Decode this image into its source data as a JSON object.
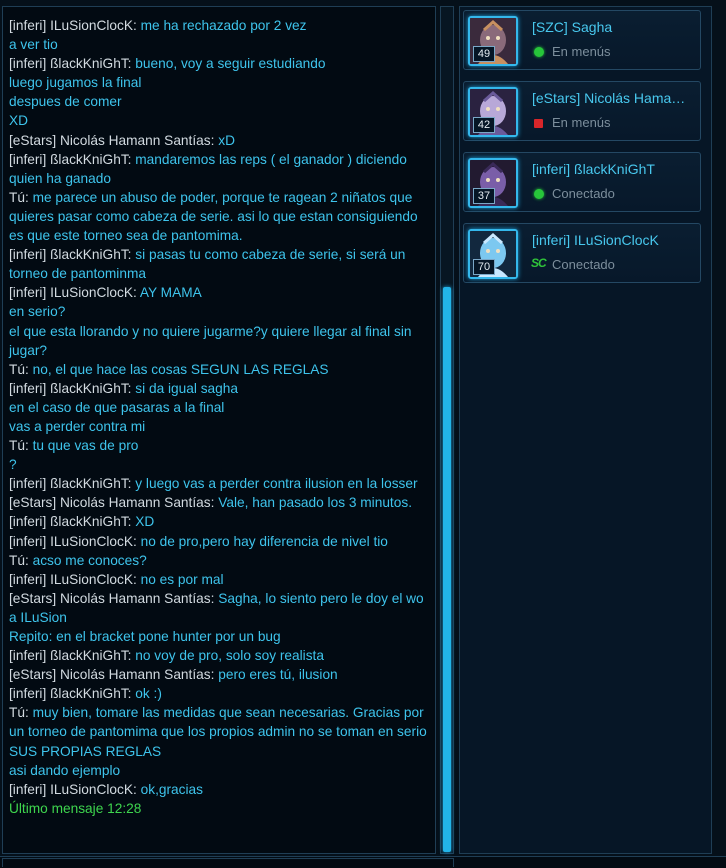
{
  "chat": {
    "lines": [
      {
        "sender": "[inferi] ILuSionClocK:",
        "text": "me ha rechazado por 2 vez"
      },
      {
        "sender": "",
        "text": "a ver tio"
      },
      {
        "sender": "[inferi] ßlackKniGhT:",
        "text": "bueno, voy a seguir estudiando"
      },
      {
        "sender": "",
        "text": "luego jugamos la final"
      },
      {
        "sender": "",
        "text": "despues de comer"
      },
      {
        "sender": "",
        "text": "XD"
      },
      {
        "sender": "[eStars] Nicolás Hamann Santías:",
        "text": "xD"
      },
      {
        "sender": "[inferi] ßlackKniGhT:",
        "text": "mandaremos las reps ( el ganador ) diciendo quien ha ganado"
      },
      {
        "sender": "Tú:",
        "text": "me parece un abuso de poder, porque te ragean 2 niñatos que quieres pasar como cabeza de serie. asi lo que estan consiguiendo es que este torneo sea de pantomima."
      },
      {
        "sender": "[inferi] ßlackKniGhT:",
        "text": "si pasas tu como cabeza de serie, si será un torneo de pantominma"
      },
      {
        "sender": "[inferi] ILuSionClocK:",
        "text": "AY MAMA"
      },
      {
        "sender": "",
        "text": "en serio?"
      },
      {
        "sender": "",
        "text": "el que esta llorando y no quiere jugarme?y quiere llegar  al final sin jugar?"
      },
      {
        "sender": "Tú:",
        "text": "no, el que hace las cosas SEGUN LAS REGLAS"
      },
      {
        "sender": "[inferi] ßlackKniGhT:",
        "text": "si da igual sagha"
      },
      {
        "sender": "",
        "text": "en el caso de que pasaras a la final"
      },
      {
        "sender": "",
        "text": "vas a perder contra mi"
      },
      {
        "sender": "Tú:",
        "text": "tu que vas de pro"
      },
      {
        "sender": "",
        "text": "?"
      },
      {
        "sender": "[inferi] ßlackKniGhT:",
        "text": "y luego vas a perder contra ilusion en la losser"
      },
      {
        "sender": "[eStars] Nicolás Hamann Santías:",
        "text": "Vale, han pasado los 3 minutos."
      },
      {
        "sender": "[inferi] ßlackKniGhT:",
        "text": "XD"
      },
      {
        "sender": "[inferi] ILuSionClocK:",
        "text": "no de pro,pero hay diferencia de nivel tio"
      },
      {
        "sender": "Tú:",
        "text": "acso me conoces?"
      },
      {
        "sender": "[inferi] ILuSionClocK:",
        "text": "no es por mal"
      },
      {
        "sender": "[eStars] Nicolás Hamann Santías:",
        "text": "Sagha, lo siento pero le doy el wo a ILuSion"
      },
      {
        "sender": "",
        "text": "Repito: en el bracket pone hunter por un bug"
      },
      {
        "sender": "[inferi] ßlackKniGhT:",
        "text": "no voy de pro, solo soy realista"
      },
      {
        "sender": "[eStars] Nicolás Hamann Santías:",
        "text": "pero eres tú, ilusion"
      },
      {
        "sender": "[inferi] ßlackKniGhT:",
        "text": "ok :)"
      },
      {
        "sender": "Tú:",
        "text": "muy bien, tomare las medidas que sean necesarias. Gracias por un torneo de pantomima que los propios admin no se toman en serio SUS PROPIAS REGLAS"
      },
      {
        "sender": "",
        "text": "asi dando ejemplo"
      },
      {
        "sender": "[inferi] ILuSionClocK:",
        "text": "ok,gracias"
      }
    ],
    "last_message": "Último mensaje 12:28"
  },
  "friends": [
    {
      "name": "[SZC] Sagha",
      "level": "49",
      "status": "En menús",
      "status_icon": "green-dot-icon",
      "art": "purple"
    },
    {
      "name": "[eStars] Nicolás Hamann Santías",
      "level": "42",
      "status": "En menús",
      "status_icon": "red-square-icon",
      "art": "zerg"
    },
    {
      "name": "[inferi] ßlackKniGhT",
      "level": "37",
      "status": "Conectado",
      "status_icon": "green-dot-icon",
      "art": "dark"
    },
    {
      "name": "[inferi] ILuSionClocK",
      "level": "70",
      "status": "Conectado",
      "status_icon": "sc2-game-icon",
      "art": "protoss"
    }
  ],
  "colors": {
    "message": "#3ec4ec",
    "sender": "#d2dae0",
    "accent": "#22b4e8",
    "online": "#27c63a",
    "busy": "#d8262a"
  },
  "icons": {
    "sc2_game_label": "SC"
  }
}
